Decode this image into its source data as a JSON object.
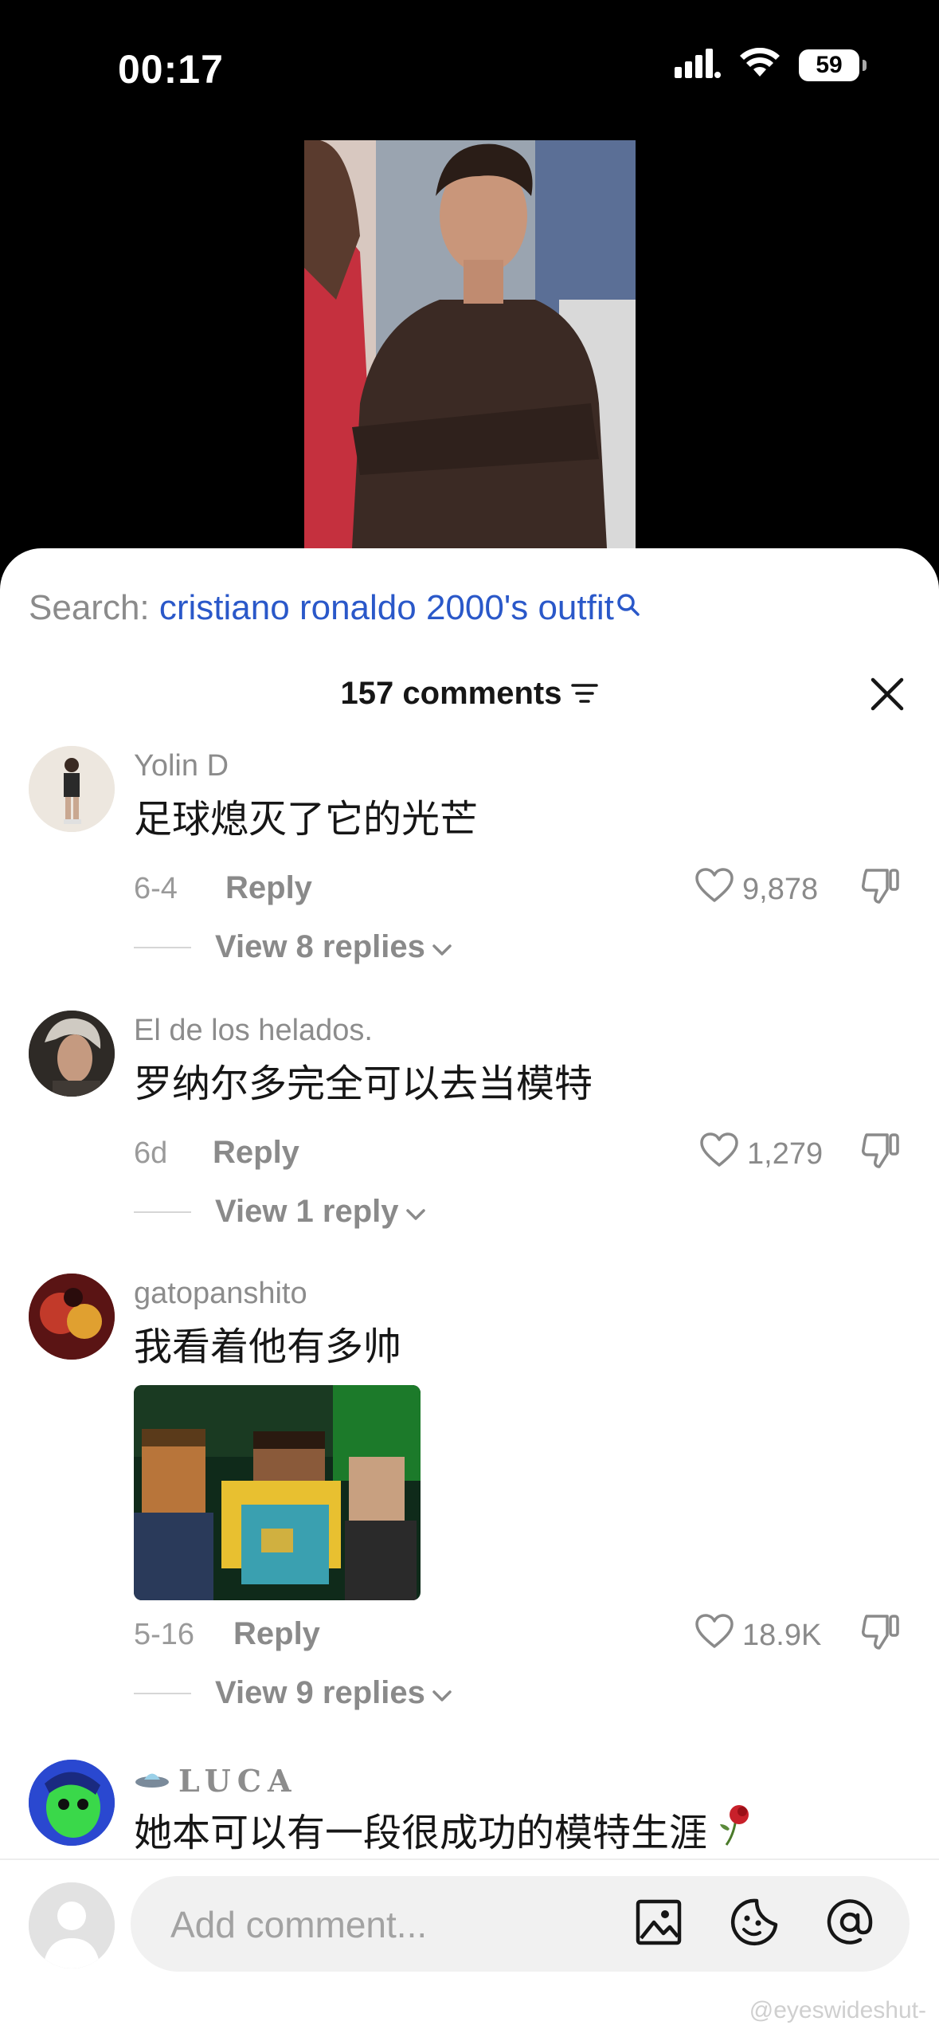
{
  "status": {
    "time": "00:17",
    "battery": "59"
  },
  "search": {
    "prefix": "Search: ",
    "query": "cristiano ronaldo 2000's outfit"
  },
  "header": {
    "count_label": "157 comments"
  },
  "comments": [
    {
      "user": "Yolin D",
      "text": "足球熄灭了它的光芒",
      "date": "6-4",
      "reply": "Reply",
      "likes": "9,878",
      "view_replies": "View 8 replies"
    },
    {
      "user": "El de los helados.",
      "text": "罗纳尔多完全可以去当模特",
      "date": "6d",
      "reply": "Reply",
      "likes": "1,279",
      "view_replies": "View 1 reply"
    },
    {
      "user": "gatopanshito",
      "text": "我看着他有多帅",
      "date": "5-16",
      "reply": "Reply",
      "likes": "18.9K",
      "view_replies": "View 9 replies"
    },
    {
      "user": "LUCA",
      "text": "她本可以有一段很成功的模特生涯"
    }
  ],
  "composer": {
    "placeholder": "Add comment..."
  },
  "watermark": "@eyeswideshut-",
  "icons": {
    "signal": "cellular-signal-icon",
    "wifi": "wifi-icon",
    "search": "search-icon",
    "sort": "sort-icon",
    "close": "close-icon",
    "heart": "heart-icon",
    "dislike": "thumbs-down-icon",
    "chevron": "chevron-down-icon",
    "image": "image-icon",
    "emoji": "emoji-icon",
    "mention": "at-icon",
    "ufo": "ufo-icon",
    "rose": "wilted-rose-icon"
  },
  "colors": {
    "search_query": "#2a58c9",
    "background_top": "#000000",
    "sheet": "#ffffff"
  }
}
